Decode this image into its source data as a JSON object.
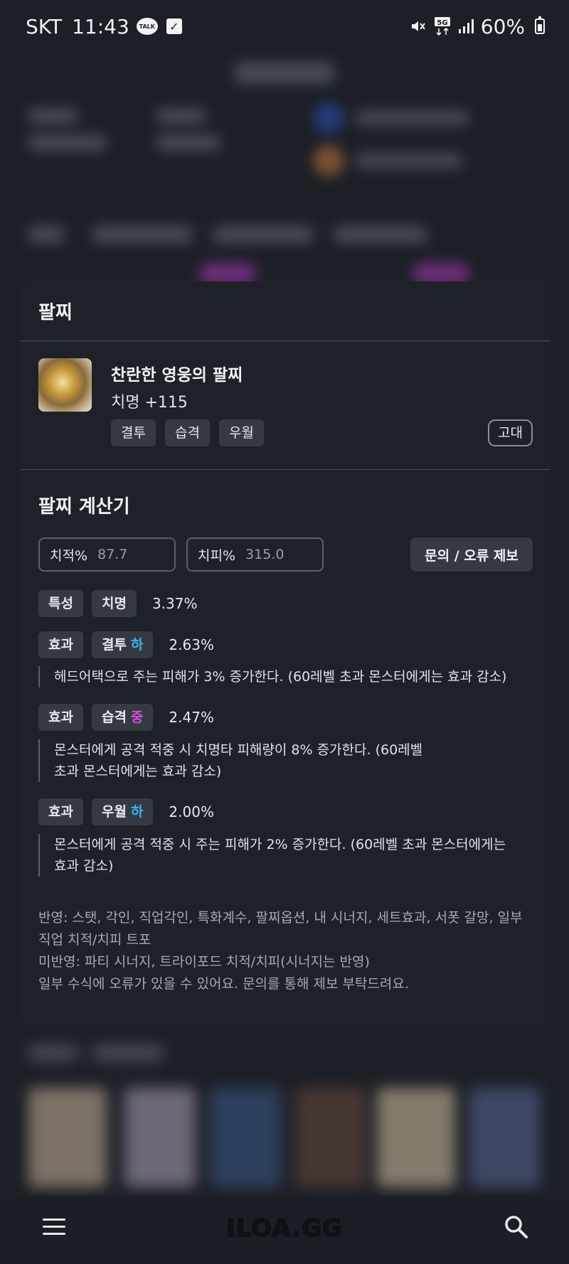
{
  "status_bar": {
    "carrier": "SKT",
    "time": "11:43",
    "talk_label": "TALK",
    "network": "5G",
    "battery": "60%"
  },
  "modal": {
    "title": "팔찌",
    "item": {
      "name": "찬란한 영웅의 팔찌",
      "stat": "치명 +115",
      "grade": "고대",
      "tags": [
        "결투",
        "습격",
        "우월"
      ]
    },
    "calculator": {
      "title": "팔찌 계산기",
      "crit_rate": {
        "label": "치적%",
        "value": "87.7"
      },
      "crit_dmg": {
        "label": "치피%",
        "value": "315.0"
      },
      "report_button": "문의 / 오류 제보",
      "trait": {
        "type": "특성",
        "name": "치명",
        "percent": "3.37%"
      },
      "effects": [
        {
          "type": "효과",
          "name": "결투",
          "grade": "하",
          "grade_color": "#38b6f0",
          "percent": "2.63%",
          "description": "헤드어택으로 주는 피해가 3% 증가한다. (60레벨 초과 몬스터에게는 효과 감소)"
        },
        {
          "type": "효과",
          "name": "습격",
          "grade": "중",
          "grade_color": "#d64fd8",
          "percent": "2.47%",
          "description": "몬스터에게 공격 적중 시 치명타 피해량이 8% 증가한다. (60레벨 초과 몬스터에게는 효과 감소)"
        },
        {
          "type": "효과",
          "name": "우월",
          "grade": "하",
          "grade_color": "#38b6f0",
          "percent": "2.00%",
          "description": "몬스터에게 공격 적중 시 주는 피해가 2% 증가한다. (60레벨 초과 몬스터에게는 효과 감소)"
        }
      ],
      "notes": [
        "반영: 스탯, 각인, 직업각인, 특화계수, 팔찌옵션, 내 시너지, 세트효과, 서폿 갈망, 일부 직업 치적/치피 트포",
        "미반영: 파티 시너지, 트라이포드 치적/치피(시너지는 반영)",
        "일부 수식에 오류가 있을 수 있어요. 문의를 통해 제보 부탁드려요."
      ]
    }
  },
  "bottom_nav": {
    "logo": "ILOA.GG",
    "menu_icon": "menu-icon",
    "search_icon": "search-icon"
  }
}
